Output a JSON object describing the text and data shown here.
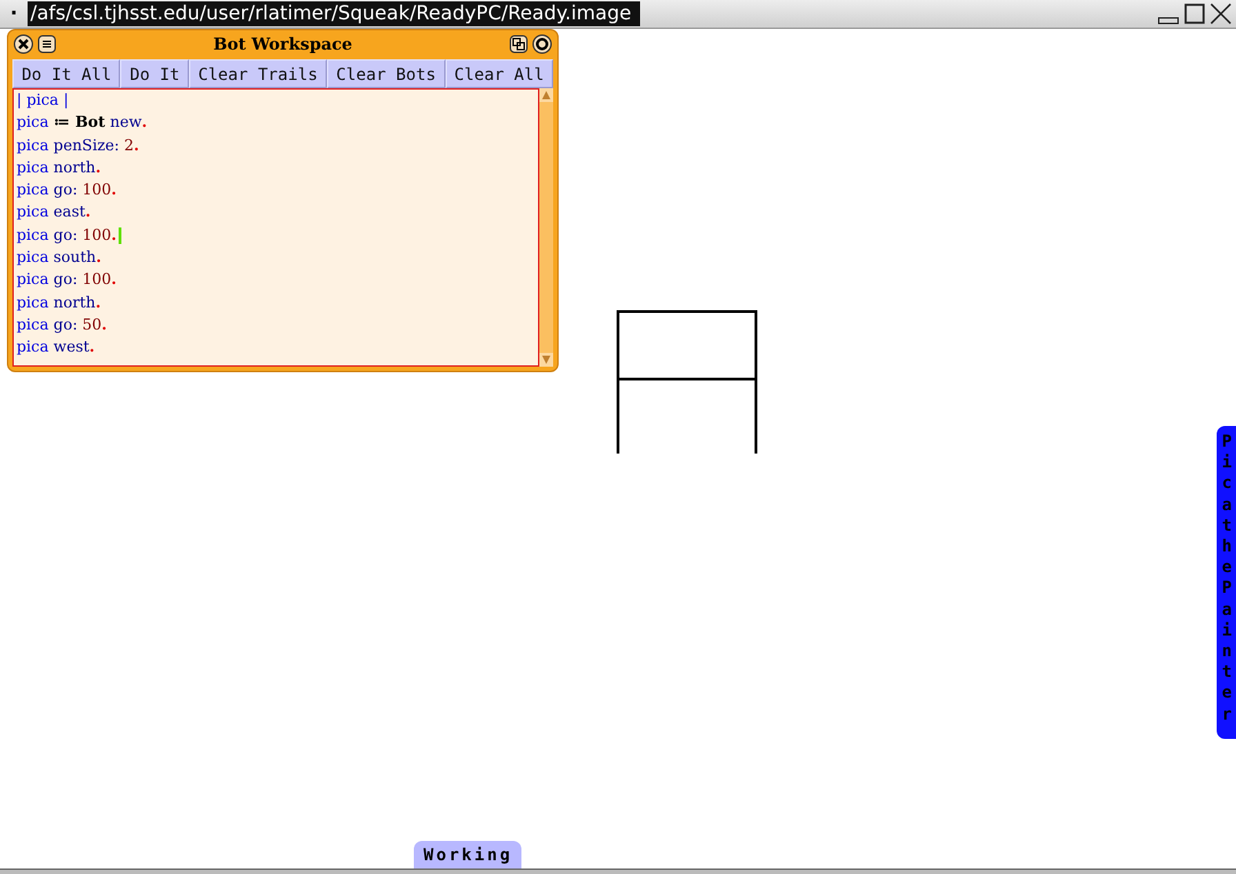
{
  "window": {
    "menu_glyph": "·",
    "title": "/afs/csl.tjhsst.edu/user/rlatimer/Squeak/ReadyPC/Ready.image"
  },
  "workspace": {
    "title": "Bot Workspace",
    "buttons": [
      "Do It All",
      "Do It",
      "Clear Trails",
      "Clear Bots",
      "Clear All"
    ],
    "code_lines": [
      [
        {
          "kind": "var",
          "text": "| pica |"
        }
      ],
      [
        {
          "kind": "var",
          "text": "pica "
        },
        {
          "kind": "class",
          "text": "≔ Bot"
        },
        {
          "kind": "msg",
          "text": " new"
        },
        {
          "kind": "dot",
          "text": "."
        }
      ],
      [
        {
          "kind": "var",
          "text": "pica "
        },
        {
          "kind": "msg",
          "text": "penSize: "
        },
        {
          "kind": "num",
          "text": "2"
        },
        {
          "kind": "dot",
          "text": "."
        }
      ],
      [
        {
          "kind": "var",
          "text": "pica "
        },
        {
          "kind": "msg",
          "text": "north"
        },
        {
          "kind": "dot",
          "text": "."
        }
      ],
      [
        {
          "kind": "var",
          "text": "pica "
        },
        {
          "kind": "msg",
          "text": "go: "
        },
        {
          "kind": "num",
          "text": "100"
        },
        {
          "kind": "dot",
          "text": "."
        }
      ],
      [
        {
          "kind": "var",
          "text": "pica "
        },
        {
          "kind": "msg",
          "text": "east"
        },
        {
          "kind": "dot",
          "text": "."
        }
      ],
      [
        {
          "kind": "var",
          "text": "pica "
        },
        {
          "kind": "msg",
          "text": "go: "
        },
        {
          "kind": "num",
          "text": "100"
        },
        {
          "kind": "dot",
          "text": "."
        },
        {
          "kind": "cursor"
        }
      ],
      [
        {
          "kind": "var",
          "text": "pica "
        },
        {
          "kind": "msg",
          "text": "south"
        },
        {
          "kind": "dot",
          "text": "."
        }
      ],
      [
        {
          "kind": "var",
          "text": "pica "
        },
        {
          "kind": "msg",
          "text": "go: "
        },
        {
          "kind": "num",
          "text": "100"
        },
        {
          "kind": "dot",
          "text": "."
        }
      ],
      [
        {
          "kind": "var",
          "text": "pica "
        },
        {
          "kind": "msg",
          "text": "north"
        },
        {
          "kind": "dot",
          "text": "."
        }
      ],
      [
        {
          "kind": "var",
          "text": "pica "
        },
        {
          "kind": "msg",
          "text": "go: "
        },
        {
          "kind": "num",
          "text": "50"
        },
        {
          "kind": "dot",
          "text": "."
        }
      ],
      [
        {
          "kind": "var",
          "text": "pica "
        },
        {
          "kind": "msg",
          "text": "west"
        },
        {
          "kind": "dot",
          "text": "."
        }
      ]
    ]
  },
  "side_tab": {
    "label": "Pica the Painter"
  },
  "bottom_tab": {
    "label": "Working"
  }
}
